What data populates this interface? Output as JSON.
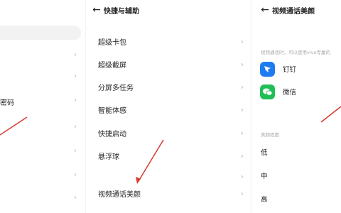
{
  "left_panel": {
    "partial_label": "密码"
  },
  "mid_panel": {
    "header": {
      "title": "快捷与辅助"
    },
    "items": [
      {
        "label": "超级卡包"
      },
      {
        "label": "超级截屏"
      },
      {
        "label": "分屏多任务"
      },
      {
        "label": "智能体感"
      },
      {
        "label": "快捷启动"
      },
      {
        "label": "悬浮球"
      },
      {
        "label": "视频通话美颜"
      }
    ]
  },
  "right_panel": {
    "header": {
      "title": "视频通话美颜"
    },
    "hint": "视频通话时，可以使用vivo专属的",
    "apps": [
      {
        "name": "钉钉",
        "icon": "dingtalk-icon",
        "color": "#1f7cf0"
      },
      {
        "name": "微信",
        "icon": "wechat-icon",
        "color": "#1fbf55"
      }
    ],
    "beauty_label": "美颜程度",
    "levels": [
      "低",
      "中",
      "高"
    ]
  },
  "colors": {
    "arrow": "#d63a2f",
    "chevron": "#b8b8b8",
    "hint": "#a8a8a8"
  }
}
